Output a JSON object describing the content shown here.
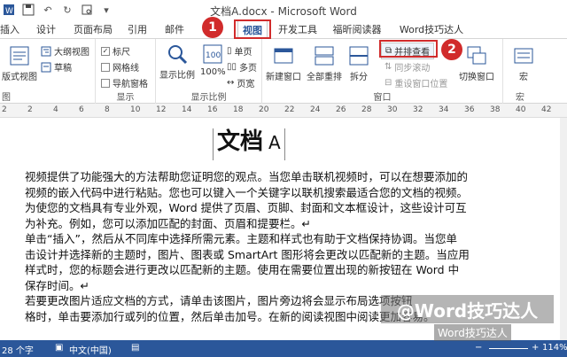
{
  "window": {
    "title": "文档A.docx - Microsoft Word"
  },
  "tabs": [
    {
      "label": "插入"
    },
    {
      "label": "设计"
    },
    {
      "label": "页面布局"
    },
    {
      "label": "引用"
    },
    {
      "label": "邮件"
    },
    {
      "label": "审阅"
    },
    {
      "label": "视图"
    },
    {
      "label": "开发工具"
    },
    {
      "label": "福昕阅读器"
    },
    {
      "label": "Word技巧达人"
    }
  ],
  "ribbon": {
    "views": {
      "web_layout": "版式视图",
      "outline": "大纲视图",
      "draft": "草稿",
      "label": "图"
    },
    "show": {
      "ruler": "标尺",
      "gridlines": "网格线",
      "nav_pane": "导航窗格",
      "label": "显示"
    },
    "zoom": {
      "zoom": "显示比例",
      "hundred": "100%",
      "one_page": "单页",
      "multi_page": "多页",
      "page_width": "页宽",
      "label": "显示比例"
    },
    "window": {
      "new_window": "新建窗口",
      "arrange_all": "全部重排",
      "split": "拆分",
      "side_by_side": "并排查看",
      "sync_scroll": "同步滚动",
      "reset_pos": "重设窗口位置",
      "switch": "切换窗口",
      "label": "窗口"
    },
    "macros": {
      "macro": "宏",
      "label": "宏"
    }
  },
  "ruler": {
    "numbers": [
      "2",
      "2",
      "4",
      "6",
      "8",
      "10",
      "12",
      "14",
      "16",
      "18",
      "20",
      "22",
      "24",
      "26",
      "28",
      "30",
      "32",
      "34",
      "36",
      "38",
      "40",
      "42"
    ]
  },
  "document": {
    "title": "文档",
    "title_suffix": "A",
    "lines": [
      "视频提供了功能强大的方法帮助您证明您的观点。当您单击联机视频时，可以在想要添加的",
      "视频的嵌入代码中进行粘贴。您也可以键入一个关键字以联机搜索最适合您的文档的视频。",
      "为使您的文档具有专业外观，Word 提供了页眉、页脚、封面和文本框设计，这些设计可互",
      "为补充。例如，您可以添加匹配的封面、页眉和提要栏。↵",
      "单击“插入”，然后从不同库中选择所需元素。主题和样式也有助于文档保持协调。当您单",
      "击设计并选择新的主题时，图片、图表或 SmartArt 图形将会更改以匹配新的主题。当应用",
      "样式时，您的标题会进行更改以匹配新的主题。使用在需要位置出现的新按钮在 Word 中",
      "保存时间。↵",
      "若要更改图片适应文档的方式，请单击该图片，图片旁边将会显示布局选项按钮",
      "格时，单击要添加行或列的位置，然后单击加号。在新的阅读视图中阅读更加容易。"
    ]
  },
  "status": {
    "words": "28 个字",
    "language": "中文(中国)",
    "zoom": "114%"
  },
  "annotations": {
    "badge1": "1",
    "badge2": "2"
  },
  "overlay": {
    "watermark": "@Word技巧达人",
    "wechat": "Word技巧达人"
  },
  "colors": {
    "accent": "#2b579a",
    "highlight": "#d12b2b"
  }
}
